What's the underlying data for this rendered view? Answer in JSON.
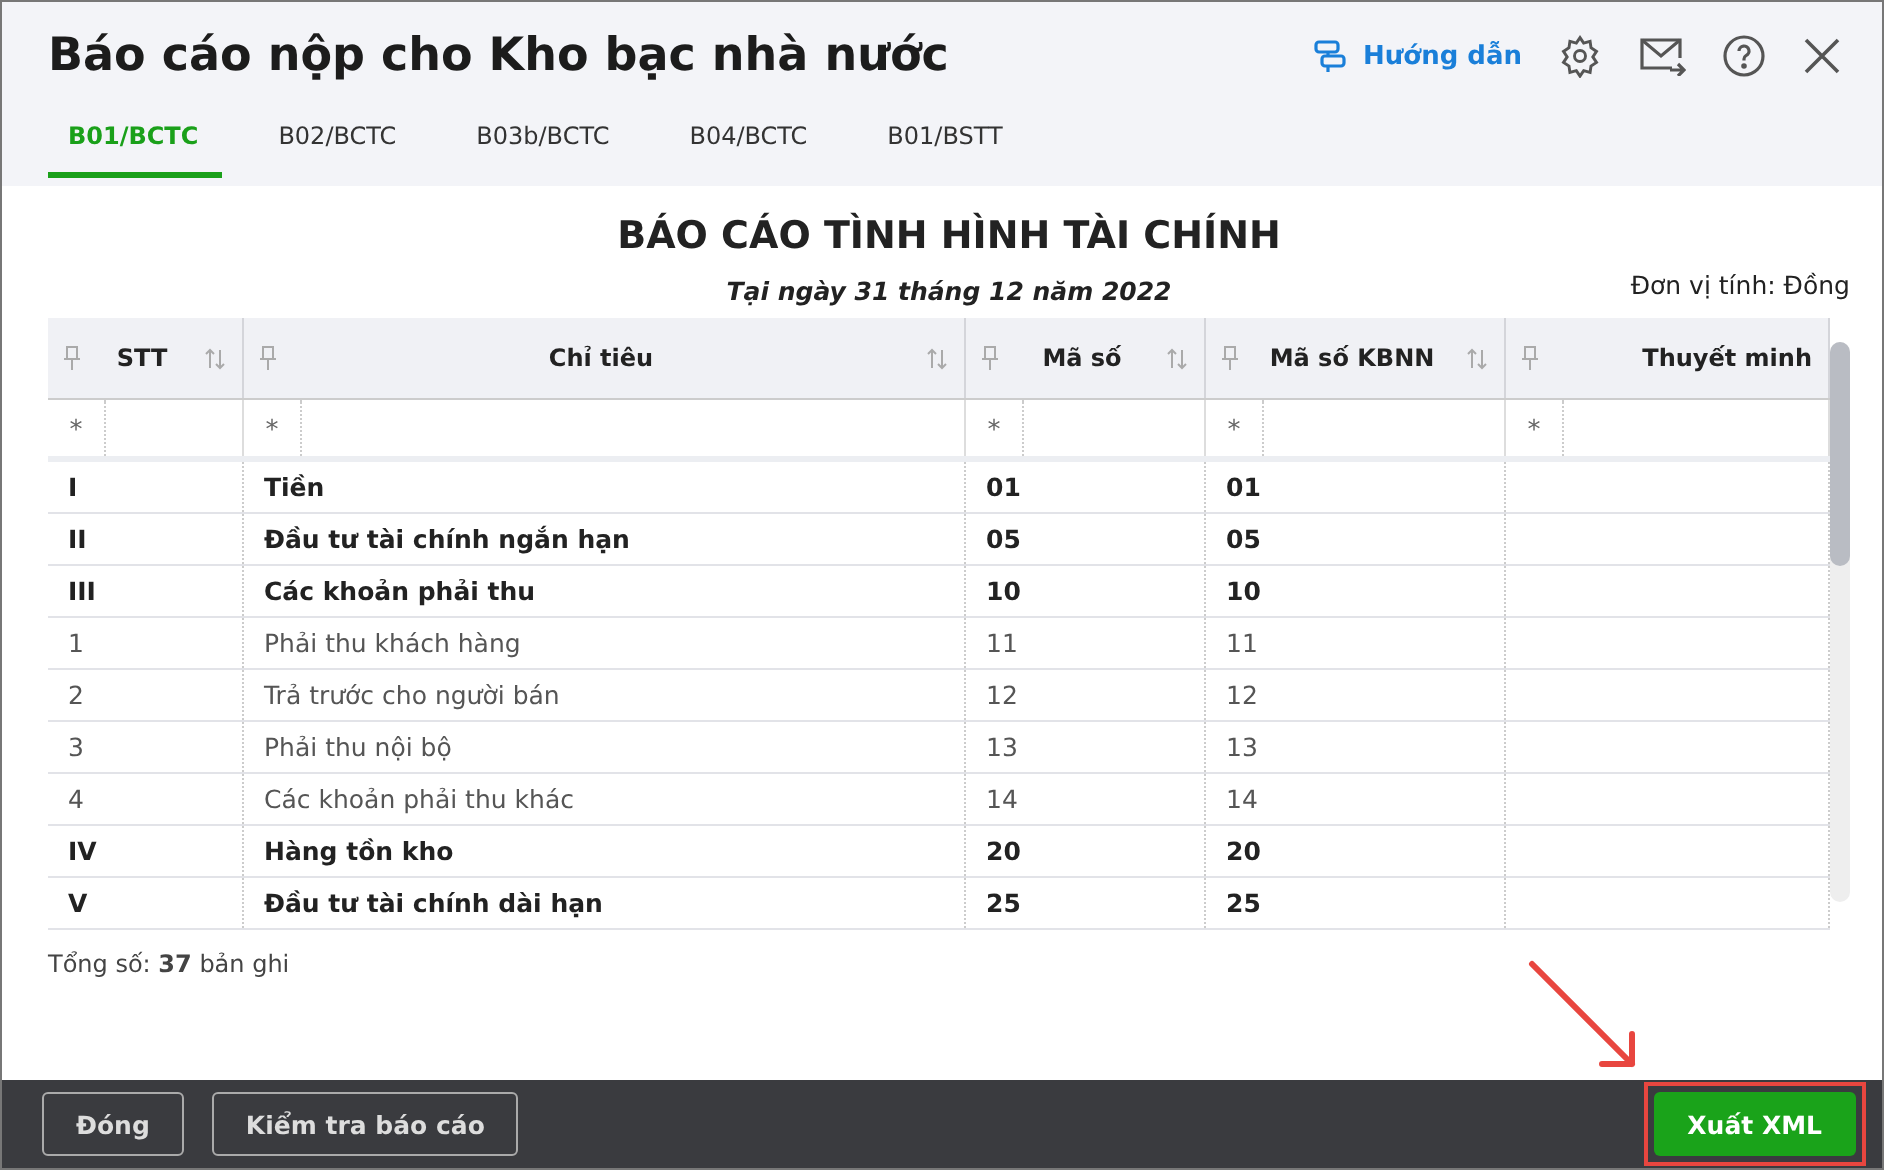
{
  "window": {
    "title": "Báo cáo nộp cho Kho bạc nhà nước"
  },
  "header_actions": {
    "guide": "Hướng dẫn"
  },
  "tabs": [
    {
      "label": "B01/BCTC",
      "selected": true
    },
    {
      "label": "B02/BCTC",
      "selected": false
    },
    {
      "label": "B03b/BCTC",
      "selected": false
    },
    {
      "label": "B04/BCTC",
      "selected": false
    },
    {
      "label": "B01/BSTT",
      "selected": false
    }
  ],
  "report": {
    "title": "BÁO CÁO TÌNH HÌNH TÀI CHÍNH",
    "date": "Tại ngày 31 tháng 12 năm 2022",
    "unit": "Đơn vị tính: Đồng"
  },
  "table": {
    "columns": [
      {
        "label": "STT",
        "sortable": true
      },
      {
        "label": "Chỉ tiêu",
        "sortable": true
      },
      {
        "label": "Mã số",
        "sortable": true
      },
      {
        "label": "Mã số KBNN",
        "sortable": true
      },
      {
        "label": "Thuyết minh",
        "sortable": false
      }
    ],
    "filter_mark": "*",
    "rows": [
      {
        "cells": [
          "I",
          "Tiền",
          "01",
          "01",
          ""
        ],
        "bold": true
      },
      {
        "cells": [
          "II",
          "Đầu tư tài chính ngắn hạn",
          "05",
          "05",
          ""
        ],
        "bold": true
      },
      {
        "cells": [
          "III",
          "Các khoản phải thu",
          "10",
          "10",
          ""
        ],
        "bold": true
      },
      {
        "cells": [
          "1",
          "Phải thu khách hàng",
          "11",
          "11",
          ""
        ],
        "bold": false
      },
      {
        "cells": [
          "2",
          "Trả trước cho người bán",
          "12",
          "12",
          ""
        ],
        "bold": false
      },
      {
        "cells": [
          "3",
          "Phải thu nội bộ",
          "13",
          "13",
          ""
        ],
        "bold": false
      },
      {
        "cells": [
          "4",
          "Các khoản phải thu khác",
          "14",
          "14",
          ""
        ],
        "bold": false
      },
      {
        "cells": [
          "IV",
          "Hàng tồn kho",
          "20",
          "20",
          ""
        ],
        "bold": true
      },
      {
        "cells": [
          "V",
          "Đầu tư tài chính dài hạn",
          "25",
          "25",
          ""
        ],
        "bold": true
      }
    ],
    "total": "Tổng số: **37** bản ghi"
  },
  "footer": {
    "buttons": [
      {
        "label": "Đóng",
        "kind": "outline"
      },
      {
        "label": "Kiểm tra báo cáo",
        "kind": "outline"
      },
      {
        "label": "Xuất XML",
        "kind": "primary",
        "highlighted": true
      }
    ]
  }
}
